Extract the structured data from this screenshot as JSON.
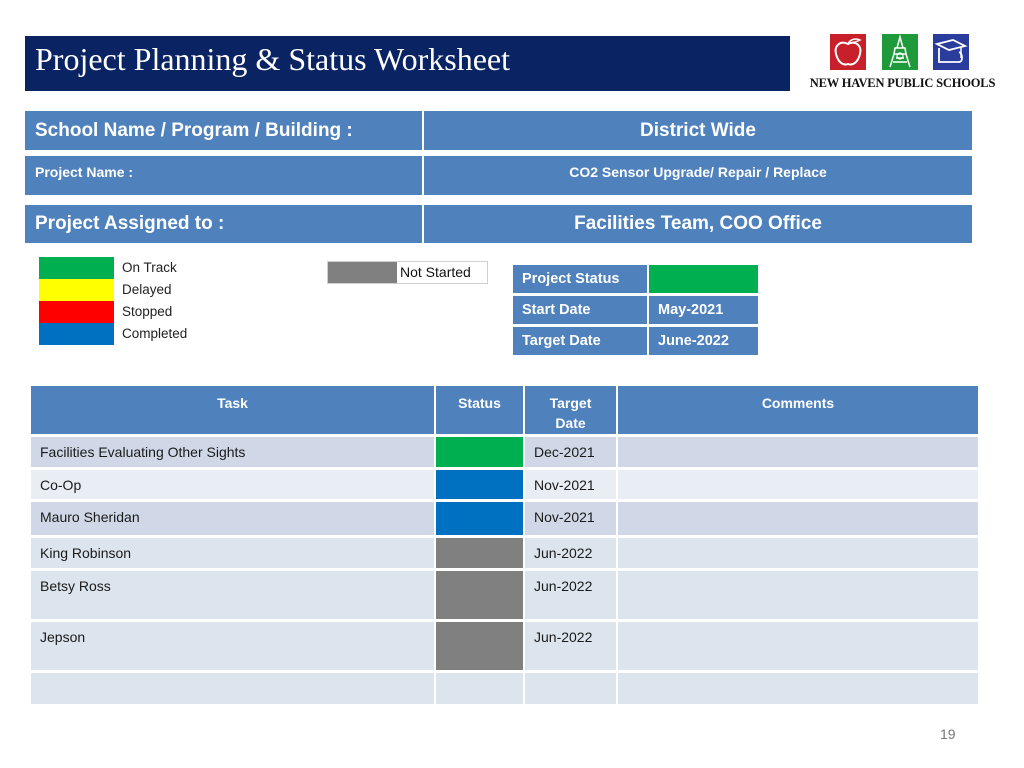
{
  "header": {
    "title": "Project Planning & Status Worksheet",
    "logo": {
      "org_name": "NEW HAVEN PUBLIC SCHOOLS",
      "icons": [
        "apple-icon",
        "tower-icon",
        "graduation-cap-icon"
      ]
    }
  },
  "info": {
    "school": {
      "label": "School Name / Program / Building :",
      "value": "District Wide"
    },
    "project_name": {
      "label": "Project Name :",
      "value": "CO2 Sensor Upgrade/ Repair / Replace"
    },
    "assigned_to": {
      "label": "Project Assigned to :",
      "value": "Facilities Team, COO Office"
    }
  },
  "legend": {
    "items": [
      {
        "label": "On Track",
        "color": "#00b050"
      },
      {
        "label": "Delayed",
        "color": "#ffff00"
      },
      {
        "label": "Stopped",
        "color": "#ff0000"
      },
      {
        "label": "Completed",
        "color": "#0070c0"
      }
    ],
    "not_started": {
      "label": "Not Started",
      "color": "#808080"
    }
  },
  "project_status": {
    "status_label": "Project Status",
    "status_color": "#00b050",
    "start_label": "Start Date",
    "start_value": "May-2021",
    "target_label": "Target  Date",
    "target_value": "June-2022"
  },
  "tasks": {
    "headers": {
      "task": "Task",
      "status": "Status",
      "target_line1": "Target",
      "target_line2": "Date",
      "comments": "Comments"
    },
    "rows": [
      {
        "task": "Facilities Evaluating Other Sights",
        "status": "On Track",
        "status_color": "#00b050",
        "target": "Dec-2021",
        "comments": ""
      },
      {
        "task": "Co-Op",
        "status": "Completed",
        "status_color": "#0070c0",
        "target": "Nov-2021",
        "comments": ""
      },
      {
        "task": "Mauro Sheridan",
        "status": "Completed",
        "status_color": "#0070c0",
        "target": "Nov-2021",
        "comments": ""
      },
      {
        "task": "King Robinson",
        "status": "Not Started",
        "status_color": "#808080",
        "target": "Jun-2022",
        "comments": ""
      },
      {
        "task": "Betsy Ross",
        "status": "Not Started",
        "status_color": "#808080",
        "target": "Jun-2022",
        "comments": ""
      },
      {
        "task": "Jepson",
        "status": "Not Started",
        "status_color": "#808080",
        "target": "Jun-2022",
        "comments": ""
      },
      {
        "task": "",
        "status": "",
        "status_color": "",
        "target": "",
        "comments": ""
      }
    ]
  },
  "page_number": "19"
}
